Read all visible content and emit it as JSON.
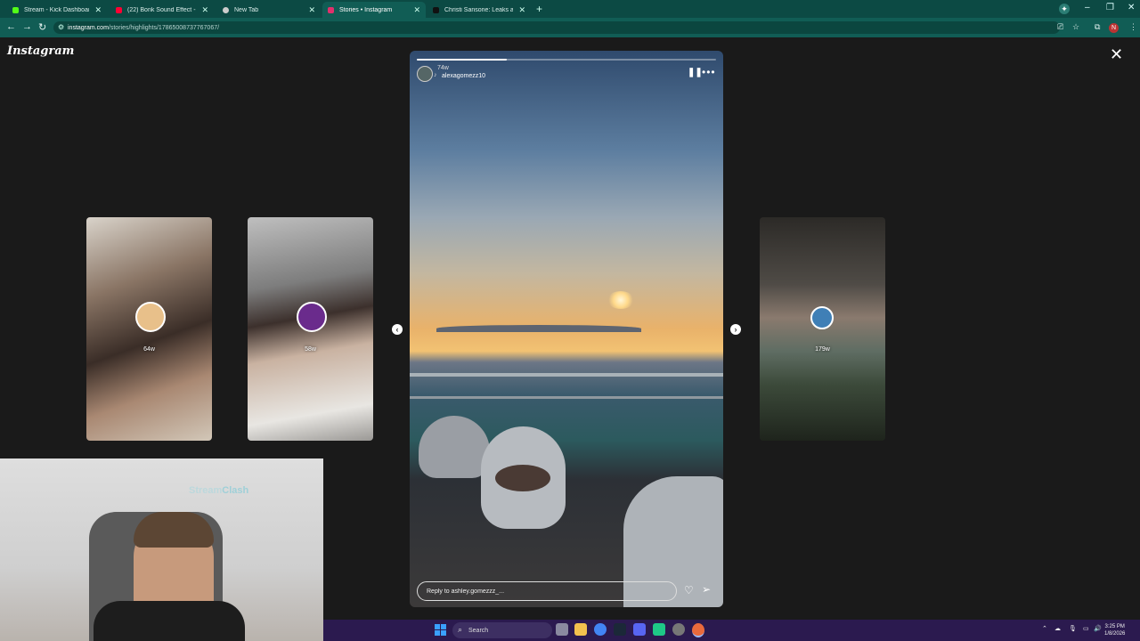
{
  "browser": {
    "tabs": [
      {
        "title": "Stream - Kick Dashboard",
        "favicon_color": "#53fc18"
      },
      {
        "title": "(22) Bonk Sound Effect - YouTube",
        "favicon_color": "#ff0033"
      },
      {
        "title": "New Tab",
        "favicon_color": "#cccccc"
      },
      {
        "title": "Stories • Instagram",
        "favicon_color": "#e1306c"
      },
      {
        "title": "Christi Sansone: Leaks and Live",
        "favicon_color": "#111111"
      }
    ],
    "active_tab_index": 3,
    "url_host": "instagram.com",
    "url_path": "/stories/highlights/17865008737767067/",
    "profile_initial": "N"
  },
  "instagram": {
    "logo": "Instagram",
    "story": {
      "time": "74w",
      "username": "alexagomezz10",
      "reply_placeholder": "Reply to ashley.gomezzz_...",
      "progress_fraction": 0.3
    },
    "thumbnails": [
      {
        "age": "64w"
      },
      {
        "age": "58w"
      },
      {
        "age": "179w"
      }
    ]
  },
  "webcam": {
    "brand_a": "Stream",
    "brand_b": "Clash"
  },
  "taskbar": {
    "search_label": "Search",
    "time": "3:25 PM",
    "date": "1/8/2026"
  }
}
